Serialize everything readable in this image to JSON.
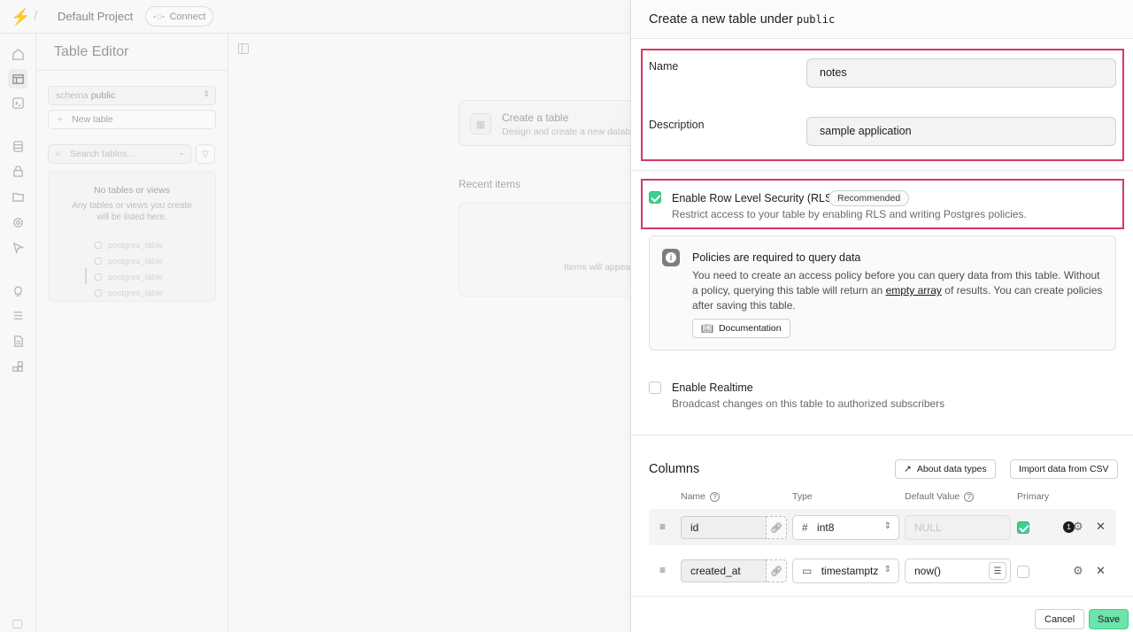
{
  "topbar": {
    "project": "Default Project",
    "connect_label": "Connect"
  },
  "sidebar": {
    "title": "Table Editor",
    "schema_prefix": "schema",
    "schema_value": "public",
    "new_table_label": "New table",
    "search_placeholder": "Search tables...",
    "empty_title": "No tables or views",
    "empty_sub": "Any tables or views you create will be listed here.",
    "ghost_rows": [
      "postgres_table",
      "postgres_table",
      "postgres_table",
      "postgres_table"
    ]
  },
  "main": {
    "create_title": "Create a table",
    "create_sub": "Design and create a new database table",
    "recent_label": "Recent items",
    "recent_empty": "Items will appear here"
  },
  "drawer": {
    "title_prefix": "Create a new table under",
    "schema": "public",
    "name_label": "Name",
    "name_value": "notes",
    "desc_label": "Description",
    "desc_value": "sample application",
    "rls_title": "Enable Row Level Security (RLS)",
    "rls_badge": "Recommended",
    "rls_desc": "Restrict access to your table by enabling RLS and writing Postgres policies.",
    "rls_checked": true,
    "policy_title": "Policies are required to query data",
    "policy_text_1": "You need to create an access policy before you can query data from this table. Without a policy, querying this table will return an",
    "policy_link": "empty array",
    "policy_text_2": "of results. You can create policies after saving this table.",
    "doc_label": "Documentation",
    "realtime_title": "Enable Realtime",
    "realtime_desc": "Broadcast changes on this table to authorized subscribers",
    "realtime_checked": false,
    "columns_title": "Columns",
    "about_types_label": "About data types",
    "import_csv_label": "Import data from CSV",
    "col_headers": {
      "name": "Name",
      "type": "Type",
      "default": "Default Value",
      "primary": "Primary"
    },
    "columns": [
      {
        "name": "id",
        "type_glyph": "#",
        "type": "int8",
        "default": "NULL",
        "default_is_placeholder": true,
        "primary": true,
        "badge": "1"
      },
      {
        "name": "created_at",
        "type_glyph": "▭",
        "type": "timestamptz",
        "default": "now()",
        "default_is_placeholder": false,
        "primary": false
      }
    ],
    "cancel_label": "Cancel",
    "save_label": "Save",
    "highlight_color": "#d4395f",
    "accent": "#3ecf8e"
  }
}
